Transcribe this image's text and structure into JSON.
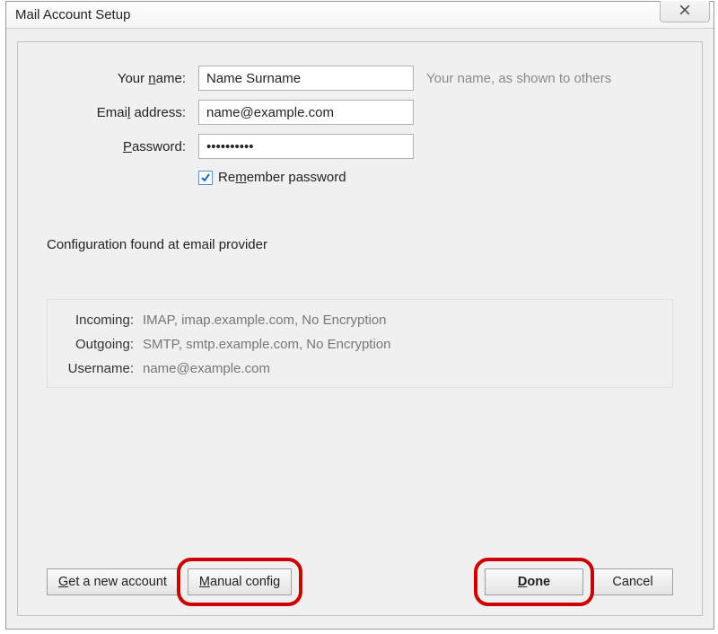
{
  "window": {
    "title": "Mail Account Setup"
  },
  "form": {
    "name_label_pre": "Your ",
    "name_label_u": "n",
    "name_label_post": "ame:",
    "name_value": "Name Surname",
    "name_hint": "Your name, as shown to others",
    "email_label_pre": "Emai",
    "email_label_u": "l",
    "email_label_post": " address:",
    "email_value": "name@example.com",
    "password_label_u": "P",
    "password_label_post": "assword:",
    "password_value": "••••••••••",
    "remember_pre": "Re",
    "remember_u": "m",
    "remember_post": "ember password"
  },
  "status": "Configuration found at email provider",
  "config": {
    "incoming_label": "Incoming:",
    "incoming_value": "IMAP, imap.example.com, No Encryption",
    "outgoing_label": "Outgoing:",
    "outgoing_value": "SMTP, smtp.example.com, No Encryption",
    "username_label": "Username:",
    "username_value": "name@example.com"
  },
  "buttons": {
    "new_account_u": "G",
    "new_account_post": "et a new account",
    "manual_u": "M",
    "manual_post": "anual config",
    "done_u": "D",
    "done_post": "one",
    "cancel": "Cancel"
  }
}
